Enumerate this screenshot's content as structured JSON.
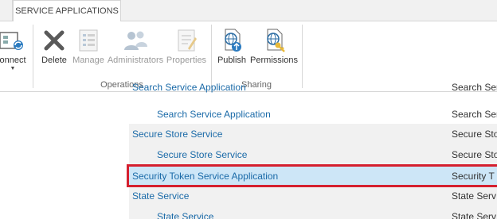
{
  "ribbon": {
    "active_tab": "SERVICE APPLICATIONS",
    "buttons": {
      "connect": "onnect",
      "delete": "Delete",
      "manage": "Manage",
      "administrators": "Administrators",
      "properties": "Properties",
      "publish": "Publish",
      "permissions": "Permissions"
    },
    "groups": {
      "first_partial": "e",
      "operations": "Operations",
      "sharing": "Sharing"
    }
  },
  "list": {
    "rows": [
      {
        "name": "Search Service Application",
        "type": "Search Ser"
      },
      {
        "name": "Search Service Application",
        "type": "Search Ser"
      },
      {
        "name": "Secure Store Service",
        "type": "Secure Sto"
      },
      {
        "name": "Secure Store Service",
        "type": "Secure Sto"
      },
      {
        "name": "Security Token Service Application",
        "type": "Security T"
      },
      {
        "name": "State Service",
        "type": "State Serv"
      },
      {
        "name": "State Service",
        "type": "State Serv"
      }
    ]
  },
  "colors": {
    "link": "#1a6aa8",
    "highlight": "#d5202f",
    "selected_row": "#cde6f7",
    "alt_row": "#f1f1f1"
  }
}
